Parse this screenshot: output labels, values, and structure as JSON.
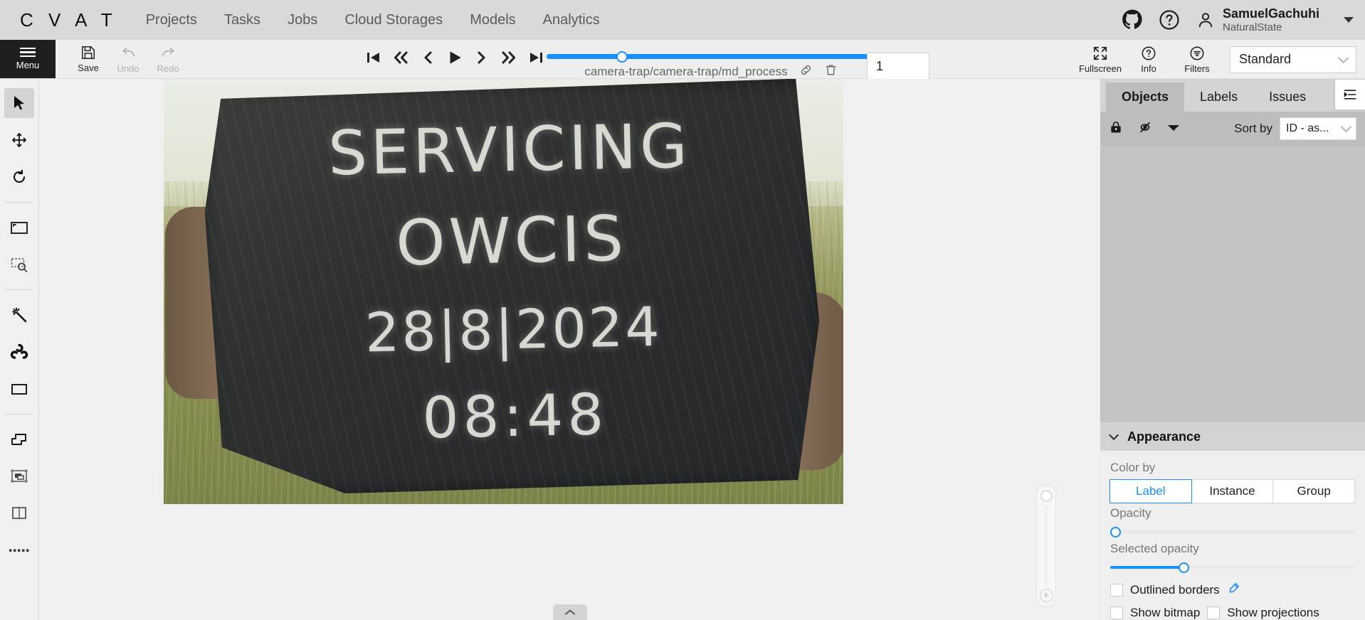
{
  "topnav": {
    "logo": "C V A T",
    "links": [
      {
        "label": "Projects"
      },
      {
        "label": "Tasks"
      },
      {
        "label": "Jobs"
      },
      {
        "label": "Cloud Storages"
      },
      {
        "label": "Models"
      },
      {
        "label": "Analytics"
      }
    ],
    "icons": [
      {
        "name": "github-icon"
      },
      {
        "name": "help-icon"
      }
    ],
    "user": {
      "name": "SamuelGachuhi",
      "org": "NaturalState"
    }
  },
  "toolbar": {
    "menu_label": "Menu",
    "save_label": "Save",
    "undo_label": "Undo",
    "redo_label": "Redo",
    "fullscreen_label": "Fullscreen",
    "info_label": "Info",
    "filters_label": "Filters",
    "workspace_value": "Standard",
    "playback": [
      {
        "name": "first-frame-button"
      },
      {
        "name": "back-fast-button"
      },
      {
        "name": "previous-frame-button"
      },
      {
        "name": "play-button"
      },
      {
        "name": "next-frame-button"
      },
      {
        "name": "forward-fast-button"
      },
      {
        "name": "last-frame-button"
      }
    ],
    "frame_name": "camera-trap/camera-trap/md_process",
    "frame_number": "1",
    "slider_percent": 23,
    "accent_color": "#1890ff"
  },
  "left_tools": [
    {
      "name": "cursor-tool",
      "active": true
    },
    {
      "name": "move-tool",
      "active": false
    },
    {
      "name": "rotate-tool",
      "active": false
    },
    {
      "name": "fit-image-tool",
      "active": false
    },
    {
      "name": "zoom-region-tool",
      "active": false
    },
    {
      "name": "magic-wand-tool",
      "active": false
    },
    {
      "name": "opencv-tool",
      "active": false
    },
    {
      "name": "rectangle-tool",
      "active": false
    },
    {
      "name": "polygon-tool",
      "active": false
    },
    {
      "name": "tag-tool",
      "active": false
    },
    {
      "name": "split-tool",
      "active": false
    },
    {
      "name": "points-tool",
      "active": false
    }
  ],
  "canvas": {
    "image_alt": "Person holding chalkboard in grass field",
    "chalk_lines": [
      "SERVICING",
      "OWCIS",
      "28|8|2024",
      "08:48"
    ],
    "zoom_in_glyph": "+"
  },
  "right_panel": {
    "tabs": [
      {
        "label": "Objects",
        "active": true
      },
      {
        "label": "Labels",
        "active": false
      },
      {
        "label": "Issues",
        "active": false
      }
    ],
    "controls": {
      "lock_icon": "lock-icon",
      "hide_icon": "hidden-eye-icon",
      "collapse_icon": "caret-down-icon",
      "sort_label": "Sort by",
      "sort_value": "ID - as..."
    },
    "appearance": {
      "title": "Appearance",
      "color_by_label": "Color by",
      "color_by_options": [
        {
          "label": "Label",
          "selected": true
        },
        {
          "label": "Instance",
          "selected": false
        },
        {
          "label": "Group",
          "selected": false
        }
      ],
      "opacity_label": "Opacity",
      "opacity_percent": 0,
      "selected_opacity_label": "Selected opacity",
      "selected_opacity_percent": 30,
      "outlined_borders_label": "Outlined borders",
      "show_bitmap_label": "Show bitmap",
      "show_projections_label": "Show projections"
    }
  }
}
